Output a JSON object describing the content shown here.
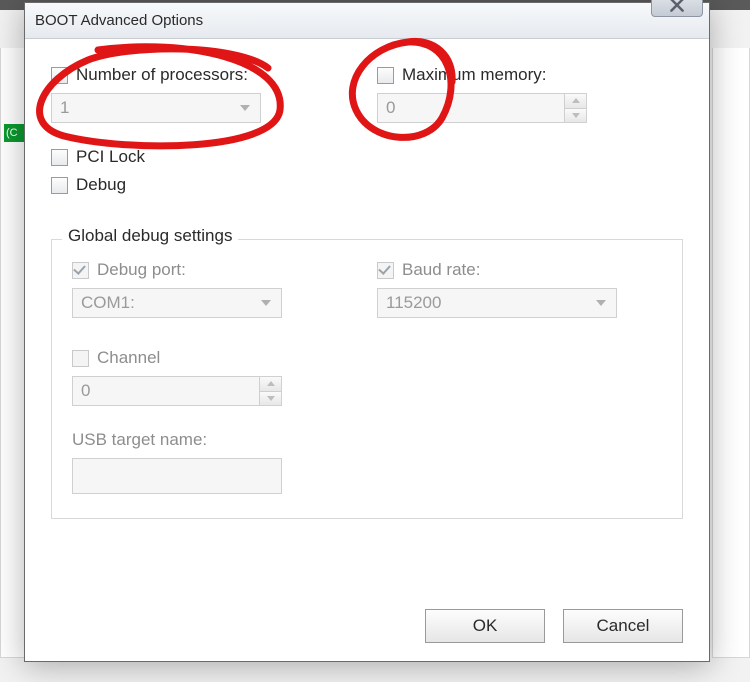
{
  "window": {
    "title": "BOOT Advanced Options"
  },
  "options": {
    "num_processors": {
      "label": "Number of processors:",
      "value": "1",
      "checked": false
    },
    "max_memory": {
      "label": "Maximum memory:",
      "value": "0",
      "checked": false
    },
    "pci_lock": {
      "label": "PCI Lock",
      "checked": false
    },
    "debug": {
      "label": "Debug",
      "checked": false
    }
  },
  "debug_group": {
    "title": "Global debug settings",
    "debug_port": {
      "label": "Debug port:",
      "value": "COM1:",
      "checked": true
    },
    "baud_rate": {
      "label": "Baud rate:",
      "value": "115200",
      "checked": true
    },
    "channel": {
      "label": "Channel",
      "value": "0",
      "checked": false
    },
    "usb_target": {
      "label": "USB target name:",
      "value": ""
    }
  },
  "buttons": {
    "ok": "OK",
    "cancel": "Cancel"
  },
  "bg_hint": "(C"
}
